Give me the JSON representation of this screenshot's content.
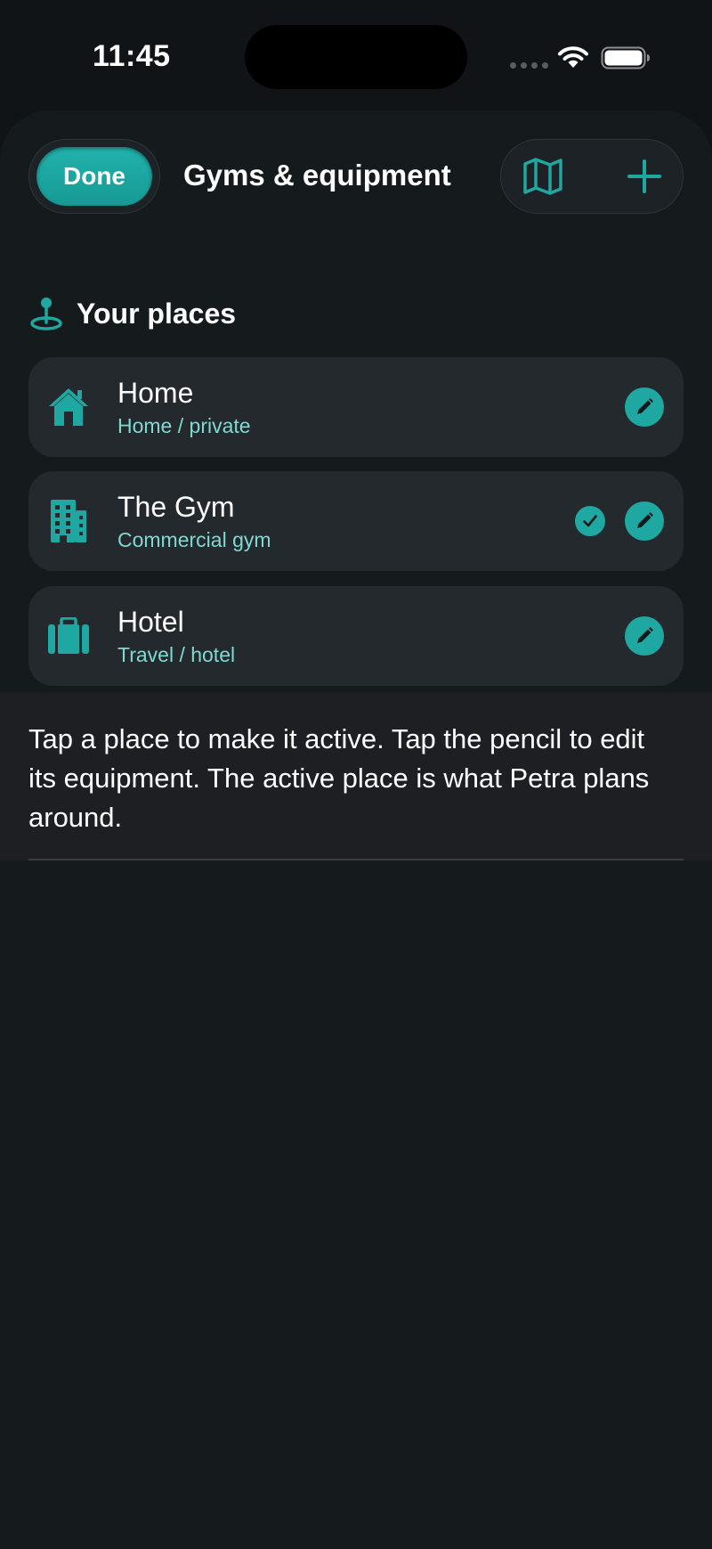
{
  "status_bar": {
    "time": "11:45"
  },
  "nav": {
    "done_label": "Done",
    "title": "Gyms & equipment",
    "map_icon": "map-icon",
    "add_icon": "plus-icon"
  },
  "section": {
    "title": "Your places",
    "icon": "map-pin-icon"
  },
  "places": [
    {
      "name": "Home",
      "subtitle": "Home / private",
      "icon": "house-icon",
      "active": false
    },
    {
      "name": "The Gym",
      "subtitle": "Commercial gym",
      "icon": "building-icon",
      "active": true
    },
    {
      "name": "Hotel",
      "subtitle": "Travel / hotel",
      "icon": "suitcase-icon",
      "active": false
    }
  ],
  "hint": {
    "text": "Tap a place to make it active. Tap the pencil to edit its equipment. The active place is what Petra plans around."
  },
  "colors": {
    "accent": "#1fa7a2",
    "subtitle": "#7fd9d2",
    "row_background": "#23292c",
    "sheet_background": "#151a1c"
  }
}
